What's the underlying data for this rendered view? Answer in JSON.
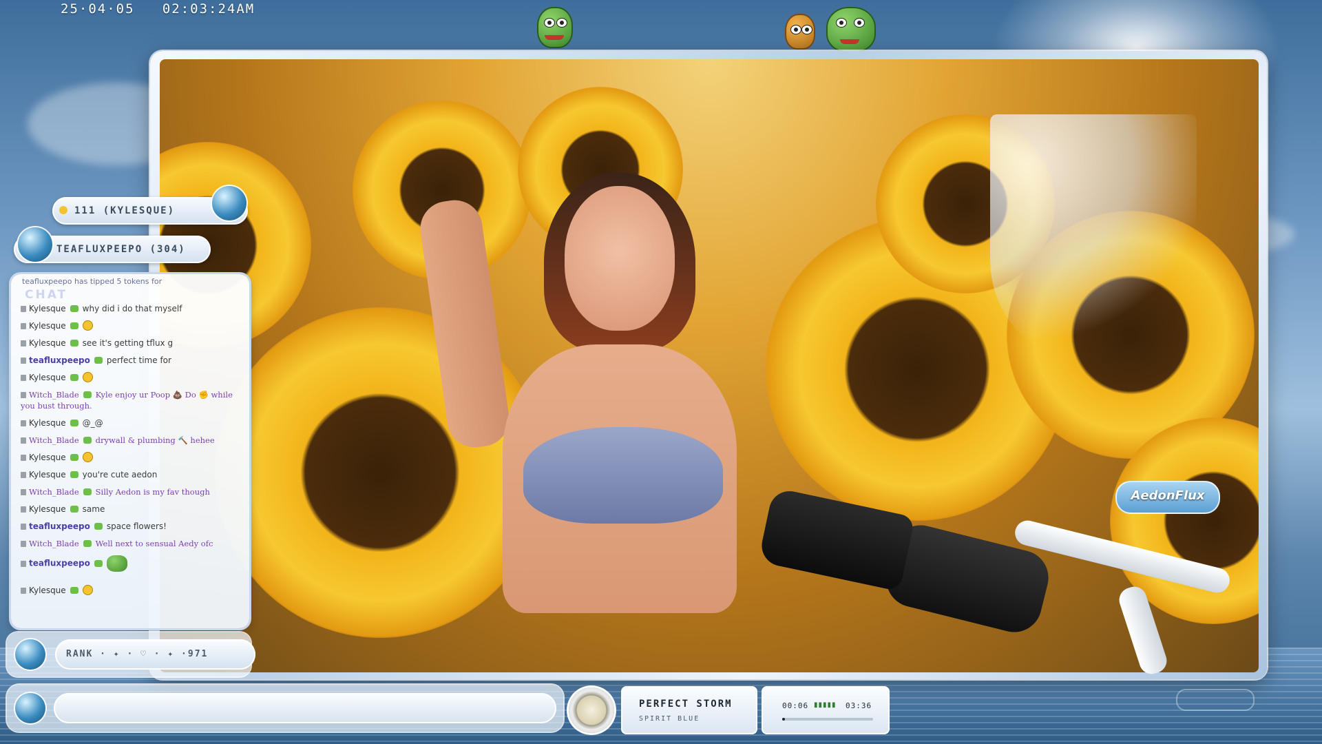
{
  "overlay": {
    "clock": "25·04·05   02:03:24AM",
    "latest_tip": "111 (KYLESQUE)",
    "top_supporter": "TEAFLUXPEEPO (304)",
    "rank_text": "RANK · ✦ · ♡ · ✦ ·971",
    "brand_logo": "AedonFlux"
  },
  "chat": {
    "top_notice": "teafluxpeepo has tipped 5 tokens for",
    "title": "CHAT",
    "messages": [
      {
        "user": "Kylesque",
        "text": "why did i do that myself",
        "kind": "plain"
      },
      {
        "user": "Kylesque",
        "text": "",
        "kind": "plain",
        "emoji": true
      },
      {
        "user": "Kylesque",
        "text": "see it's getting tflux g",
        "kind": "plain"
      },
      {
        "user": "teafluxpeepo",
        "text": "perfect time for",
        "kind": "tf"
      },
      {
        "user": "Kylesque",
        "text": "",
        "kind": "plain",
        "emoji": true
      },
      {
        "user": "Witch_Blade",
        "text": "Kyle enjoy ur Poop 💩 Do ✊ while you bust through.",
        "kind": "wb"
      },
      {
        "user": "Kylesque",
        "text": "@_@",
        "kind": "plain"
      },
      {
        "user": "Witch_Blade",
        "text": "drywall & plumbing 🔨 hehee",
        "kind": "wb"
      },
      {
        "user": "Kylesque",
        "text": "",
        "kind": "plain",
        "emoji": true
      },
      {
        "user": "Kylesque",
        "text": "you're cute aedon",
        "kind": "plain"
      },
      {
        "user": "Witch_Blade",
        "text": "Silly Aedon is my fav though",
        "kind": "wb"
      },
      {
        "user": "Kylesque",
        "text": "same",
        "kind": "plain"
      },
      {
        "user": "teafluxpeepo",
        "text": "space flowers!",
        "kind": "tf"
      },
      {
        "user": "Witch_Blade",
        "text": "Well next to sensual Aedy ofc",
        "kind": "wb"
      },
      {
        "user": "teafluxpeepo",
        "text": "",
        "kind": "tf",
        "emote": true
      },
      {
        "user": "Kylesque",
        "text": "",
        "kind": "plain",
        "emoji": true
      }
    ]
  },
  "now_playing": {
    "title": "PERFECT STORM",
    "artist": "SPIRIT BLUE",
    "elapsed": "00:06",
    "total": "03:36",
    "level_dots": "▮▮▮▮▮",
    "progress_fraction": 0.03
  },
  "colors": {
    "accent_blue": "#3b8cc0",
    "chat_purple": "#7b3fb1",
    "tipper_name": "#4a3fa8"
  }
}
